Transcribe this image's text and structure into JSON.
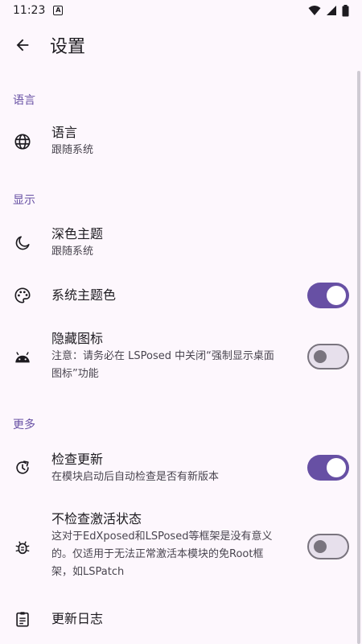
{
  "status_bar": {
    "time": "11:23",
    "notif_icon": "A"
  },
  "app_bar": {
    "back_icon": "arrow-left",
    "title": "设置"
  },
  "sections": {
    "language": {
      "header": "语言",
      "items": {
        "language": {
          "title": "语言",
          "subtitle": "跟随系统",
          "icon": "globe"
        }
      }
    },
    "display": {
      "header": "显示",
      "items": {
        "dark_theme": {
          "title": "深色主题",
          "subtitle": "跟随系统",
          "icon": "moon"
        },
        "system_color": {
          "title": "系统主题色",
          "icon": "palette",
          "enabled": true
        },
        "hide_icon": {
          "title": "隐藏图标",
          "subtitle_line1": "注意：请务必在 LSPosed 中关闭“强制显示桌面",
          "subtitle_line2": "图标”功能",
          "icon": "android",
          "enabled": false
        }
      }
    },
    "more": {
      "header": "更多",
      "items": {
        "check_update": {
          "title": "检查更新",
          "subtitle": "在模块启动后自动检查是否有新版本",
          "icon": "update",
          "enabled": true
        },
        "skip_activation": {
          "title": "不检查激活状态",
          "subtitle_line1": "这对于EdXposed和LSPosed等框架是没有意义",
          "subtitle_line2": "的。仅适用于无法正常激活本模块的免Root框",
          "subtitle_line3": "架，如LSPatch",
          "icon": "bug",
          "enabled": false
        },
        "changelog": {
          "title": "更新日志",
          "icon": "clipboard"
        }
      }
    }
  },
  "colors": {
    "accent": "#6750a4",
    "background": "#fdf7fd",
    "text": "#1d1b20",
    "secondary_text": "#49454f"
  }
}
